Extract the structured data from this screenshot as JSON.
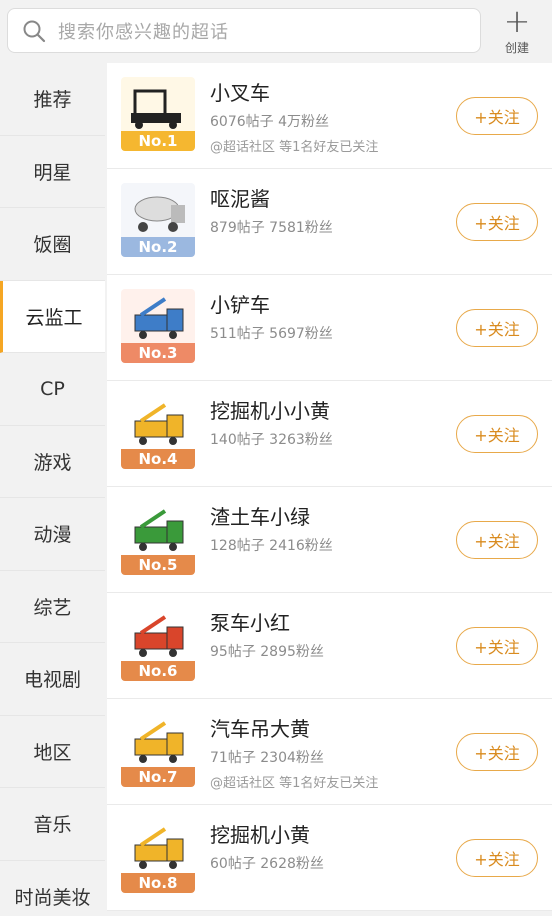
{
  "search": {
    "placeholder": "搜索你感兴趣的超话"
  },
  "create": {
    "label": "创建"
  },
  "categories": [
    {
      "label": "推荐"
    },
    {
      "label": "明星"
    },
    {
      "label": "饭圈"
    },
    {
      "label": "云监工"
    },
    {
      "label": "CP"
    },
    {
      "label": "游戏"
    },
    {
      "label": "动漫"
    },
    {
      "label": "综艺"
    },
    {
      "label": "电视剧"
    },
    {
      "label": "地区"
    },
    {
      "label": "音乐"
    },
    {
      "label": "时尚美妆"
    }
  ],
  "active_category": "云监工",
  "follow_label": "+关注",
  "items": [
    {
      "rank": "No.1",
      "name": "小叉车",
      "stats": "6076帖子 4万粉丝",
      "friend": "@超话社区 等1名好友已关注",
      "badge_color": "#f5b730"
    },
    {
      "rank": "No.2",
      "name": "呕泥酱",
      "stats": "879帖子 7581粉丝",
      "friend": "",
      "badge_color": "#9bb8e0"
    },
    {
      "rank": "No.3",
      "name": "小铲车",
      "stats": "511帖子 5697粉丝",
      "friend": "",
      "badge_color": "#ee8a66"
    },
    {
      "rank": "No.4",
      "name": "挖掘机小小黄",
      "stats": "140帖子 3263粉丝",
      "friend": "",
      "badge_color": "#e58a4a"
    },
    {
      "rank": "No.5",
      "name": "渣土车小绿",
      "stats": "128帖子 2416粉丝",
      "friend": "",
      "badge_color": "#e58a4a"
    },
    {
      "rank": "No.6",
      "name": "泵车小红",
      "stats": "95帖子 2895粉丝",
      "friend": "",
      "badge_color": "#e58a4a"
    },
    {
      "rank": "No.7",
      "name": "汽车吊大黄",
      "stats": "71帖子 2304粉丝",
      "friend": "@超话社区 等1名好友已关注",
      "badge_color": "#e58a4a"
    },
    {
      "rank": "No.8",
      "name": "挖掘机小黄",
      "stats": "60帖子 2628粉丝",
      "friend": "",
      "badge_color": "#e58a4a"
    }
  ]
}
